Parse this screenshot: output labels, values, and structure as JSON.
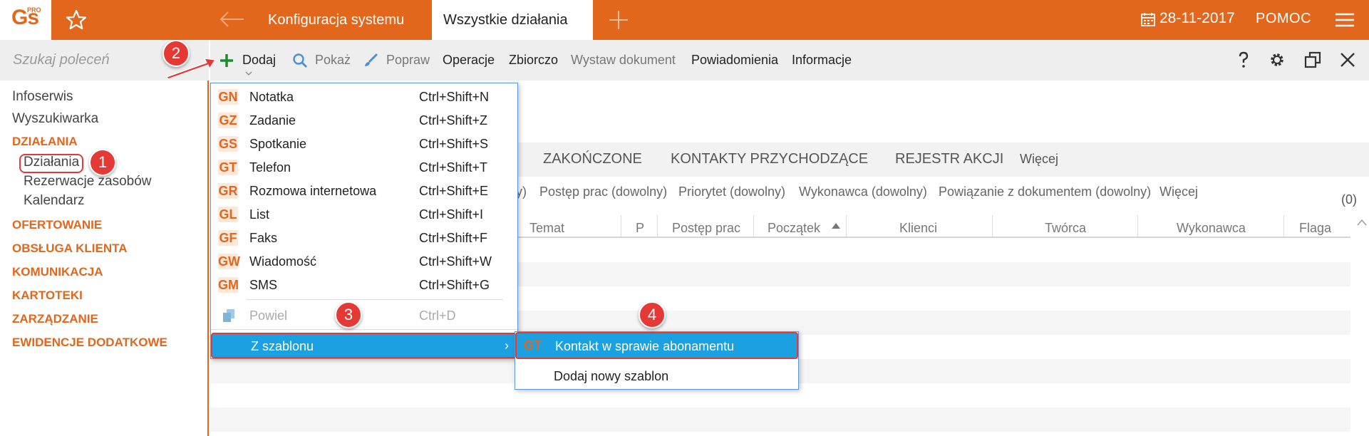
{
  "app": {
    "logo_text": "Gs",
    "logo_badge": "PRO"
  },
  "header": {
    "tabs": [
      {
        "label": "Konfiguracja systemu"
      },
      {
        "label": "Wszystkie działania"
      }
    ],
    "date": "28-11-2017",
    "help": "POMOC"
  },
  "sidebar": {
    "search_placeholder": "Szukaj poleceń",
    "items": [
      {
        "label": "Infoserwis"
      },
      {
        "label": "Wyszukiwarka"
      },
      {
        "label": "DZIAŁANIA"
      },
      {
        "label": "Działania"
      },
      {
        "label": "Rezerwacje zasobów"
      },
      {
        "label": "Kalendarz"
      },
      {
        "label": "OFERTOWANIE"
      },
      {
        "label": "OBSŁUGA KLIENTA"
      },
      {
        "label": "KOMUNIKACJA"
      },
      {
        "label": "KARTOTEKI"
      },
      {
        "label": "ZARZĄDZANIE"
      },
      {
        "label": "EWIDENCJE DODATKOWE"
      }
    ]
  },
  "toolbar": {
    "add": "Dodaj",
    "show": "Pokaż",
    "edit": "Popraw",
    "operations": "Operacje",
    "collection": "Zbiorczo",
    "issue_document": "Wystaw dokument",
    "notifications": "Powiadomienia",
    "information": "Informacje"
  },
  "content": {
    "tabs": [
      {
        "label": "ZAKOŃCZONE"
      },
      {
        "label": "KONTAKTY PRZYCHODZĄCE"
      },
      {
        "label": "REJESTR AKCJI"
      },
      {
        "label": "Więcej"
      }
    ],
    "filters": [
      {
        "label": "y)"
      },
      {
        "label": "Postęp prac (dowolny)"
      },
      {
        "label": "Priorytet (dowolny)"
      },
      {
        "label": "Wykonawca (dowolny)"
      },
      {
        "label": "Powiązanie z dokumentem (dowolny)"
      },
      {
        "label": "Więcej"
      }
    ],
    "count": "(0)",
    "columns": [
      {
        "label": "Temat"
      },
      {
        "label": "P"
      },
      {
        "label": "Postęp prac"
      },
      {
        "label": "Początek"
      },
      {
        "label": "Klienci"
      },
      {
        "label": "Twórca"
      },
      {
        "label": "Wykonawca"
      },
      {
        "label": "Flaga"
      }
    ]
  },
  "add_menu": {
    "items": [
      {
        "code": "GN",
        "label": "Notatka",
        "shortcut": "Ctrl+Shift+N"
      },
      {
        "code": "GZ",
        "label": "Zadanie",
        "shortcut": "Ctrl+Shift+Z"
      },
      {
        "code": "GS",
        "label": "Spotkanie",
        "shortcut": "Ctrl+Shift+S"
      },
      {
        "code": "GT",
        "label": "Telefon",
        "shortcut": "Ctrl+Shift+T"
      },
      {
        "code": "GR",
        "label": "Rozmowa internetowa",
        "shortcut": "Ctrl+Shift+E"
      },
      {
        "code": "GL",
        "label": "List",
        "shortcut": "Ctrl+Shift+I"
      },
      {
        "code": "GF",
        "label": "Faks",
        "shortcut": "Ctrl+Shift+F"
      },
      {
        "code": "GW",
        "label": "Wiadomość",
        "shortcut": "Ctrl+Shift+W"
      },
      {
        "code": "GM",
        "label": "SMS",
        "shortcut": "Ctrl+Shift+G"
      }
    ],
    "duplicate": {
      "label": "Powiel",
      "shortcut": "Ctrl+D"
    },
    "from_template": {
      "label": "Z szablonu",
      "arrow": "›"
    }
  },
  "template_submenu": {
    "item": {
      "code": "GT",
      "label": "Kontakt w sprawie abonamentu"
    },
    "new_template": "Dodaj nowy szablon"
  },
  "annotations": {
    "step1": "1",
    "step2": "2",
    "step3": "3",
    "step4": "4"
  },
  "colors": {
    "brand": "#e2661b",
    "highlight": "#1ba1e2",
    "annotation": "#e53935"
  }
}
